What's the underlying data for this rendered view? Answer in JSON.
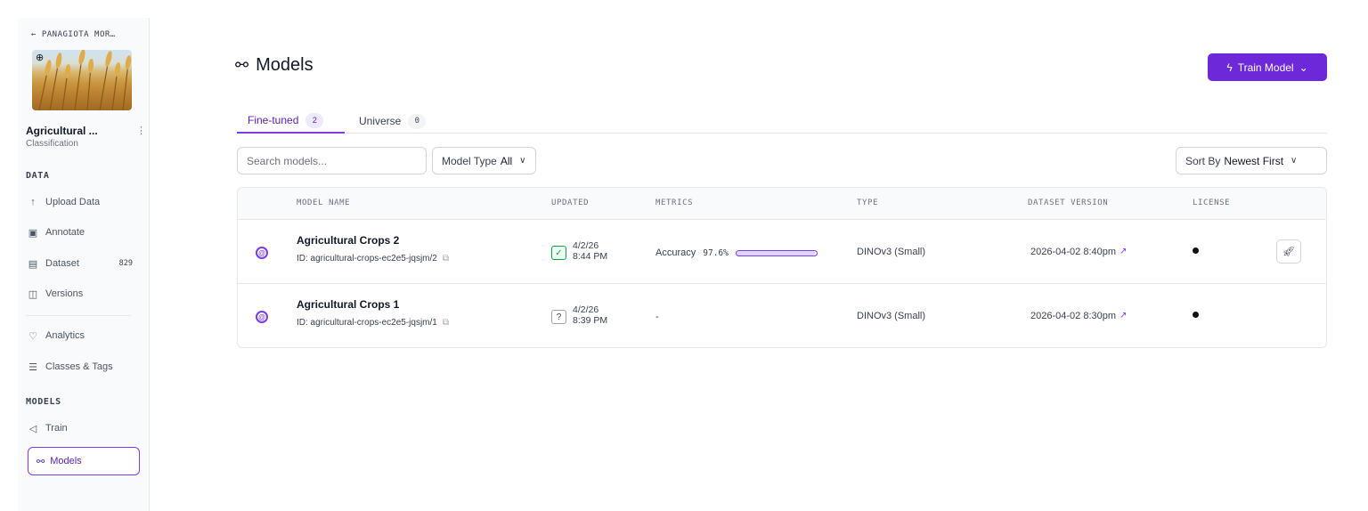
{
  "sidebar": {
    "back_label": "← PANAGIOTA MOR…",
    "project_name": "Agricultural ...",
    "project_type": "Classification",
    "data_section": "DATA",
    "data_items": [
      {
        "label": "Upload Data",
        "icon": "upload-icon"
      },
      {
        "label": "Annotate",
        "icon": "annotate-icon"
      },
      {
        "label": "Dataset",
        "icon": "dataset-icon",
        "badge": "829"
      },
      {
        "label": "Versions",
        "icon": "versions-icon"
      },
      {
        "label": "Analytics",
        "icon": "analytics-icon"
      },
      {
        "label": "Classes & Tags",
        "icon": "classes-icon"
      }
    ],
    "models_section": "MODELS",
    "models_items": [
      {
        "label": "Train",
        "icon": "train-icon"
      },
      {
        "label": "Models",
        "icon": "models-icon",
        "active": true
      }
    ]
  },
  "header": {
    "title": "Models",
    "train_button": "Train Model"
  },
  "tabs": [
    {
      "label": "Fine-tuned",
      "count": "2",
      "active": true
    },
    {
      "label": "Universe",
      "count": "0",
      "active": false
    }
  ],
  "filters": {
    "search_placeholder": "Search models...",
    "model_type_label": "Model Type",
    "model_type_value": "All",
    "sort_label": "Sort By",
    "sort_value": "Newest First"
  },
  "table": {
    "columns": [
      "MODEL NAME",
      "UPDATED",
      "METRICS",
      "TYPE",
      "DATASET VERSION",
      "LICENSE"
    ],
    "rows": [
      {
        "name": "Agricultural Crops 2",
        "model_id": "ID: agricultural-crops-ec2e5-jqsjm/2",
        "updated_status": "success",
        "updated_date": "4/2/26",
        "updated_time": "8:44 PM",
        "metric_name": "Accuracy",
        "metric_value": "97.6%",
        "metric_fraction": 0.976,
        "type": "DINOv3 (Small)",
        "dataset_version": "2026-04-02 8:40pm"
      },
      {
        "name": "Agricultural Crops 1",
        "model_id": "ID: agricultural-crops-ec2e5-jqsjm/1",
        "updated_status": "unknown",
        "updated_date": "4/2/26",
        "updated_time": "8:39 PM",
        "metric_text": "-",
        "type": "DINOv3 (Small)",
        "dataset_version": "2026-04-02 8:30pm"
      }
    ]
  },
  "colors": {
    "accent": "#6d28d9",
    "success": "#16a34a"
  }
}
